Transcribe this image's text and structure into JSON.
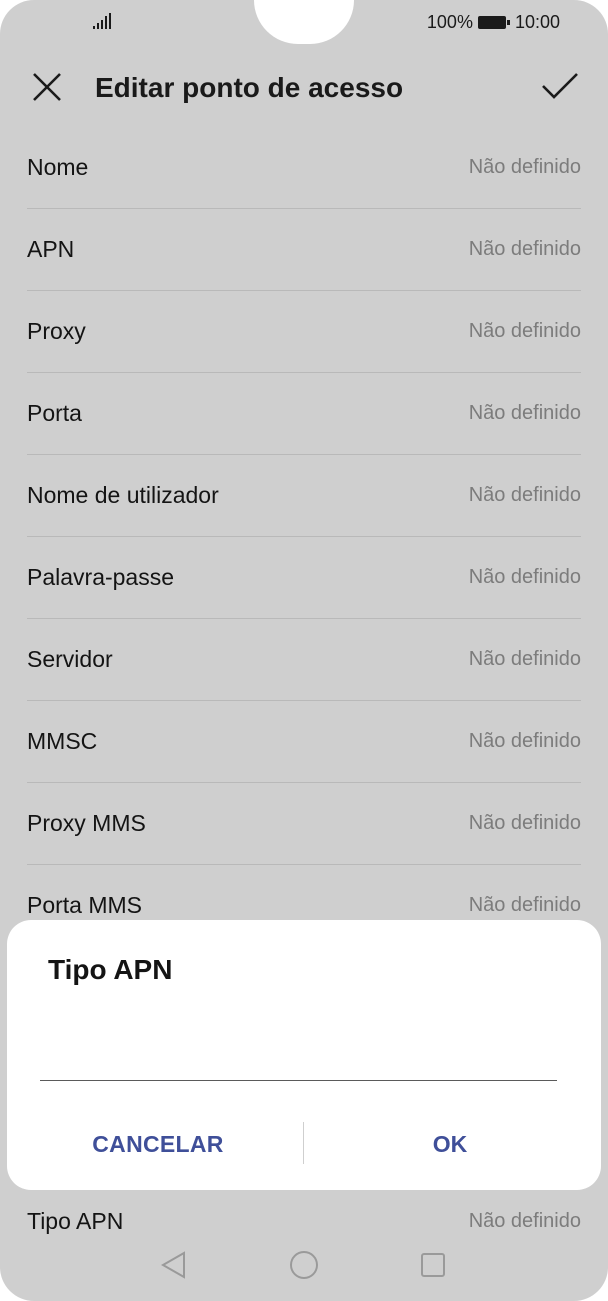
{
  "status_bar": {
    "battery": "100%",
    "time": "10:00"
  },
  "toolbar": {
    "title": "Editar ponto de acesso"
  },
  "fields": [
    {
      "label": "Nome",
      "value": "Não definido"
    },
    {
      "label": "APN",
      "value": "Não definido"
    },
    {
      "label": "Proxy",
      "value": "Não definido"
    },
    {
      "label": "Porta",
      "value": "Não definido"
    },
    {
      "label": "Nome de utilizador",
      "value": "Não definido"
    },
    {
      "label": "Palavra-passe",
      "value": "Não definido"
    },
    {
      "label": "Servidor",
      "value": "Não definido"
    },
    {
      "label": "MMSC",
      "value": "Não definido"
    },
    {
      "label": "Proxy MMS",
      "value": "Não definido"
    },
    {
      "label": "Porta MMS",
      "value": "Não definido"
    }
  ],
  "dialog": {
    "title": "Tipo APN",
    "input_value": "",
    "cancel_label": "CANCELAR",
    "ok_label": "OK"
  },
  "bottom_field": {
    "label": "Tipo APN",
    "value": "Não definido"
  },
  "colors": {
    "accent": "#3f4f99",
    "scrim": "#cfcfcf"
  }
}
